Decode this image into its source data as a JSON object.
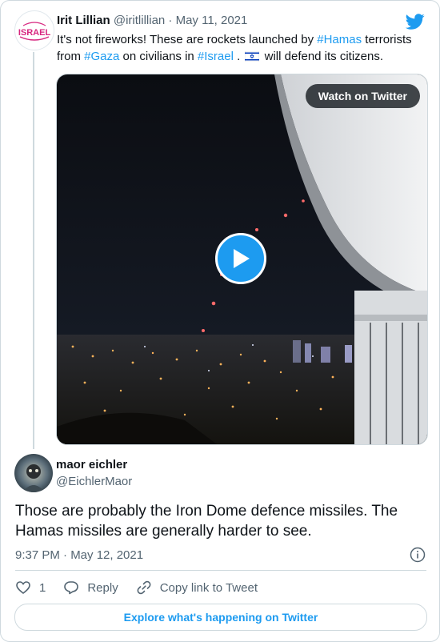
{
  "parent_tweet": {
    "author_name": "Irit Lillian",
    "handle_date": "@iritlillian · May 11, 2021",
    "avatar_text": "ISRAEL",
    "text_parts": [
      "It's not fireworks! These are rockets launched by ",
      "#Hamas",
      " terrorists from ",
      "#Gaza",
      " on civilians in ",
      "#Israel",
      " . ",
      " will defend its citizens."
    ],
    "video": {
      "watch_label": "Watch on Twitter"
    }
  },
  "reply": {
    "author_name": "maor eichler",
    "handle": "@EichlerMaor",
    "text": "Those are probably the Iron Dome defence missiles. The Hamas missiles are generally harder to see.",
    "timestamp": "9:37 PM · May 12, 2021",
    "like_count": "1",
    "reply_label": "Reply",
    "copy_link_label": "Copy link to Tweet"
  },
  "footer": {
    "explore_label": "Explore what's happening on Twitter"
  },
  "colors": {
    "link": "#1d9bf0",
    "text": "#0f1419",
    "muted": "#536471",
    "border": "#cfd9de"
  },
  "icons": [
    "twitter-bird-icon",
    "play-icon",
    "heart-icon",
    "reply-icon",
    "link-icon",
    "info-icon",
    "israel-flag-icon"
  ]
}
